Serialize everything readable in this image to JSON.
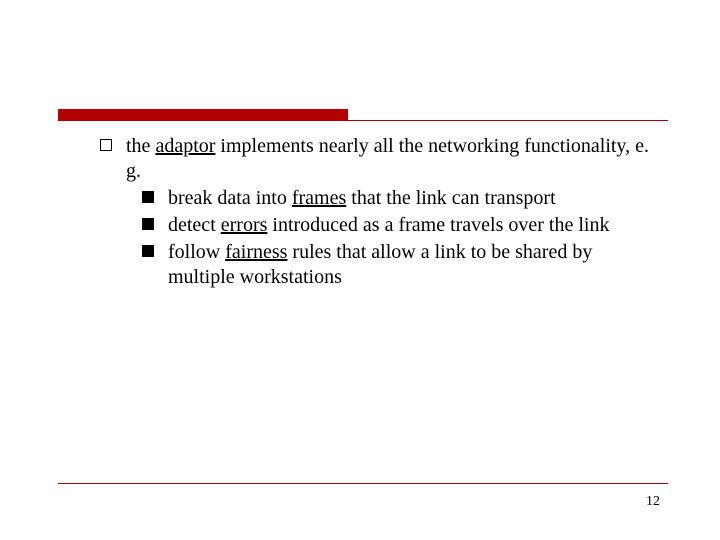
{
  "page_number": "12",
  "main_bullet": {
    "pre": "the ",
    "underlined": "adaptor",
    "post": " implements nearly all the networking functionality, e. g."
  },
  "sub_bullets": [
    {
      "pre": "break data into ",
      "underlined": "frames",
      "post": " that the link can transport"
    },
    {
      "pre": "detect ",
      "underlined": "errors",
      "post": " introduced as a frame travels over the link"
    },
    {
      "pre": "follow ",
      "underlined": "fairness",
      "post": " rules that allow a link to be shared by multiple workstations"
    }
  ]
}
